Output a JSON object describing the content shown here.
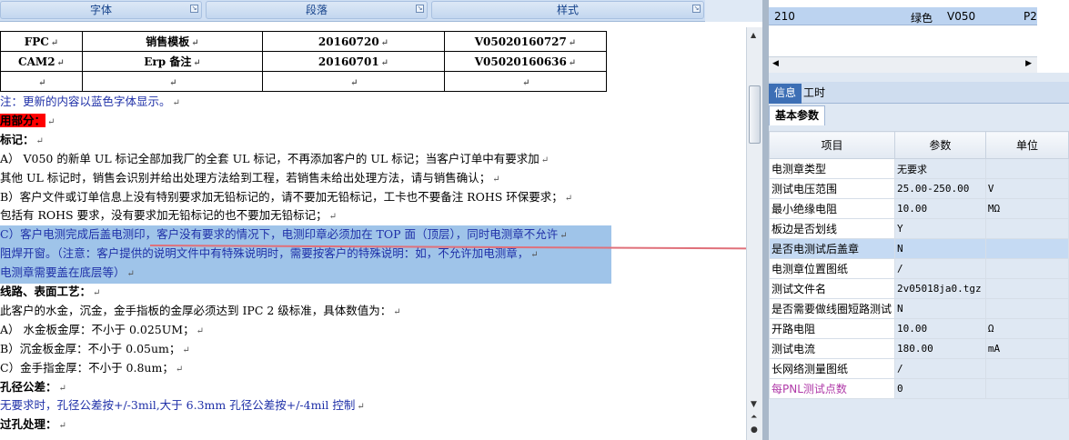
{
  "ribbon": {
    "groups": [
      "字体",
      "段落",
      "样式"
    ]
  },
  "doc_table": {
    "rows": [
      [
        "FPC",
        "销售模板",
        "20160720",
        "V05020160727"
      ],
      [
        "CAM2",
        "Erp 备注",
        "20160701",
        "V05020160636"
      ],
      [
        "",
        "",
        "",
        ""
      ]
    ]
  },
  "doc": {
    "lines": [
      {
        "text": "注：更新的内容以蓝色字体显示。",
        "style": "blue"
      },
      {
        "text": "用部分：",
        "style": "redbg"
      },
      {
        "text": "标记：",
        "style": "bold"
      },
      {
        "text": "A）     V050 的新单 UL 标记全部加我厂的全套 UL 标记，不再添加客户的 UL 标记；当客户订单中有要求加",
        "style": "normal"
      },
      {
        "text": "    其他 UL 标记时，销售会识别并给出处理方法给到工程，若销售未给出处理方法，请与销售确认；",
        "style": "normal"
      },
      {
        "text": "B）客户文件或订单信息上没有特别要求加无铅标记的，请不要加无铅标记，工卡也不要备注 ROHS 环保要求；",
        "style": "normal"
      },
      {
        "text": "    包括有 ROHS 要求，没有要求加无铅标记的也不要加无铅标记；",
        "style": "normal"
      },
      {
        "text": "C）客户电测完成后盖电测印，客户没有要求的情况下，电测印章必须加在 TOP 面（顶层），同时电测章不允许",
        "style": "sel"
      },
      {
        "text": "    阻焊开窗。（注意：客户提供的说明文件中有特殊说明时，需要按客户的特殊说明：如，不允许加电测章，",
        "style": "sel"
      },
      {
        "text": "    电测章需要盖在底层等）",
        "style": "sel"
      },
      {
        "text": "线路、表面工艺：",
        "style": "bold"
      },
      {
        "text": "此客户的水金，沉金，金手指板的金厚必须达到 IPC 2 级标准，具体数值为：",
        "style": "normal"
      },
      {
        "text": "A）     水金板金厚：不小于 0.025UM；",
        "style": "normal"
      },
      {
        "text": "B）沉金板金厚：不小于 0.05um；",
        "style": "normal"
      },
      {
        "text": "C）金手指金厚：不小于 0.8um；",
        "style": "normal"
      },
      {
        "text": "孔径公差：",
        "style": "bold"
      },
      {
        "text": "无要求时，孔径公差按+/-3mil,大于 6.3mm 孔径公差按+/-4mil 控制",
        "style": "blue"
      },
      {
        "text": "过孔处理：",
        "style": "bold"
      }
    ]
  },
  "right_panel": {
    "top_row": {
      "col1": "210",
      "col2": "绿色",
      "col3": "V050",
      "col4": "P2"
    },
    "tabs": [
      "信息",
      "工时"
    ],
    "subtab": "基本参数",
    "grid_headers": [
      "项目",
      "参数",
      "单位"
    ],
    "grid_rows": [
      {
        "item": "电测章类型",
        "param": "无要求",
        "unit": ""
      },
      {
        "item": "测试电压范围",
        "param": "25.00-250.00",
        "unit": "V"
      },
      {
        "item": "最小绝缘电阻",
        "param": "10.00",
        "unit": "MΩ"
      },
      {
        "item": "板边是否划线",
        "param": "Y",
        "unit": ""
      },
      {
        "item": "是否电测试后盖章",
        "param": "N",
        "unit": ""
      },
      {
        "item": "电测章位置图纸",
        "param": "/",
        "unit": ""
      },
      {
        "item": "测试文件名",
        "param": "2v05018ja0.tgz",
        "unit": ""
      },
      {
        "item": "是否需要做线圈短路测试",
        "param": "N",
        "unit": ""
      },
      {
        "item": "开路电阻",
        "param": "10.00",
        "unit": "Ω"
      },
      {
        "item": "测试电流",
        "param": "180.00",
        "unit": "mA"
      },
      {
        "item": "长网络测量图纸",
        "param": "/",
        "unit": ""
      },
      {
        "item": "每PNL测试点数",
        "param": "0",
        "unit": ""
      }
    ]
  },
  "colors": {
    "selection": "#9fc4e9",
    "highlight_row": "#c5daf3",
    "arrow": "#e0707a",
    "blue_text": "#1f30a8"
  }
}
